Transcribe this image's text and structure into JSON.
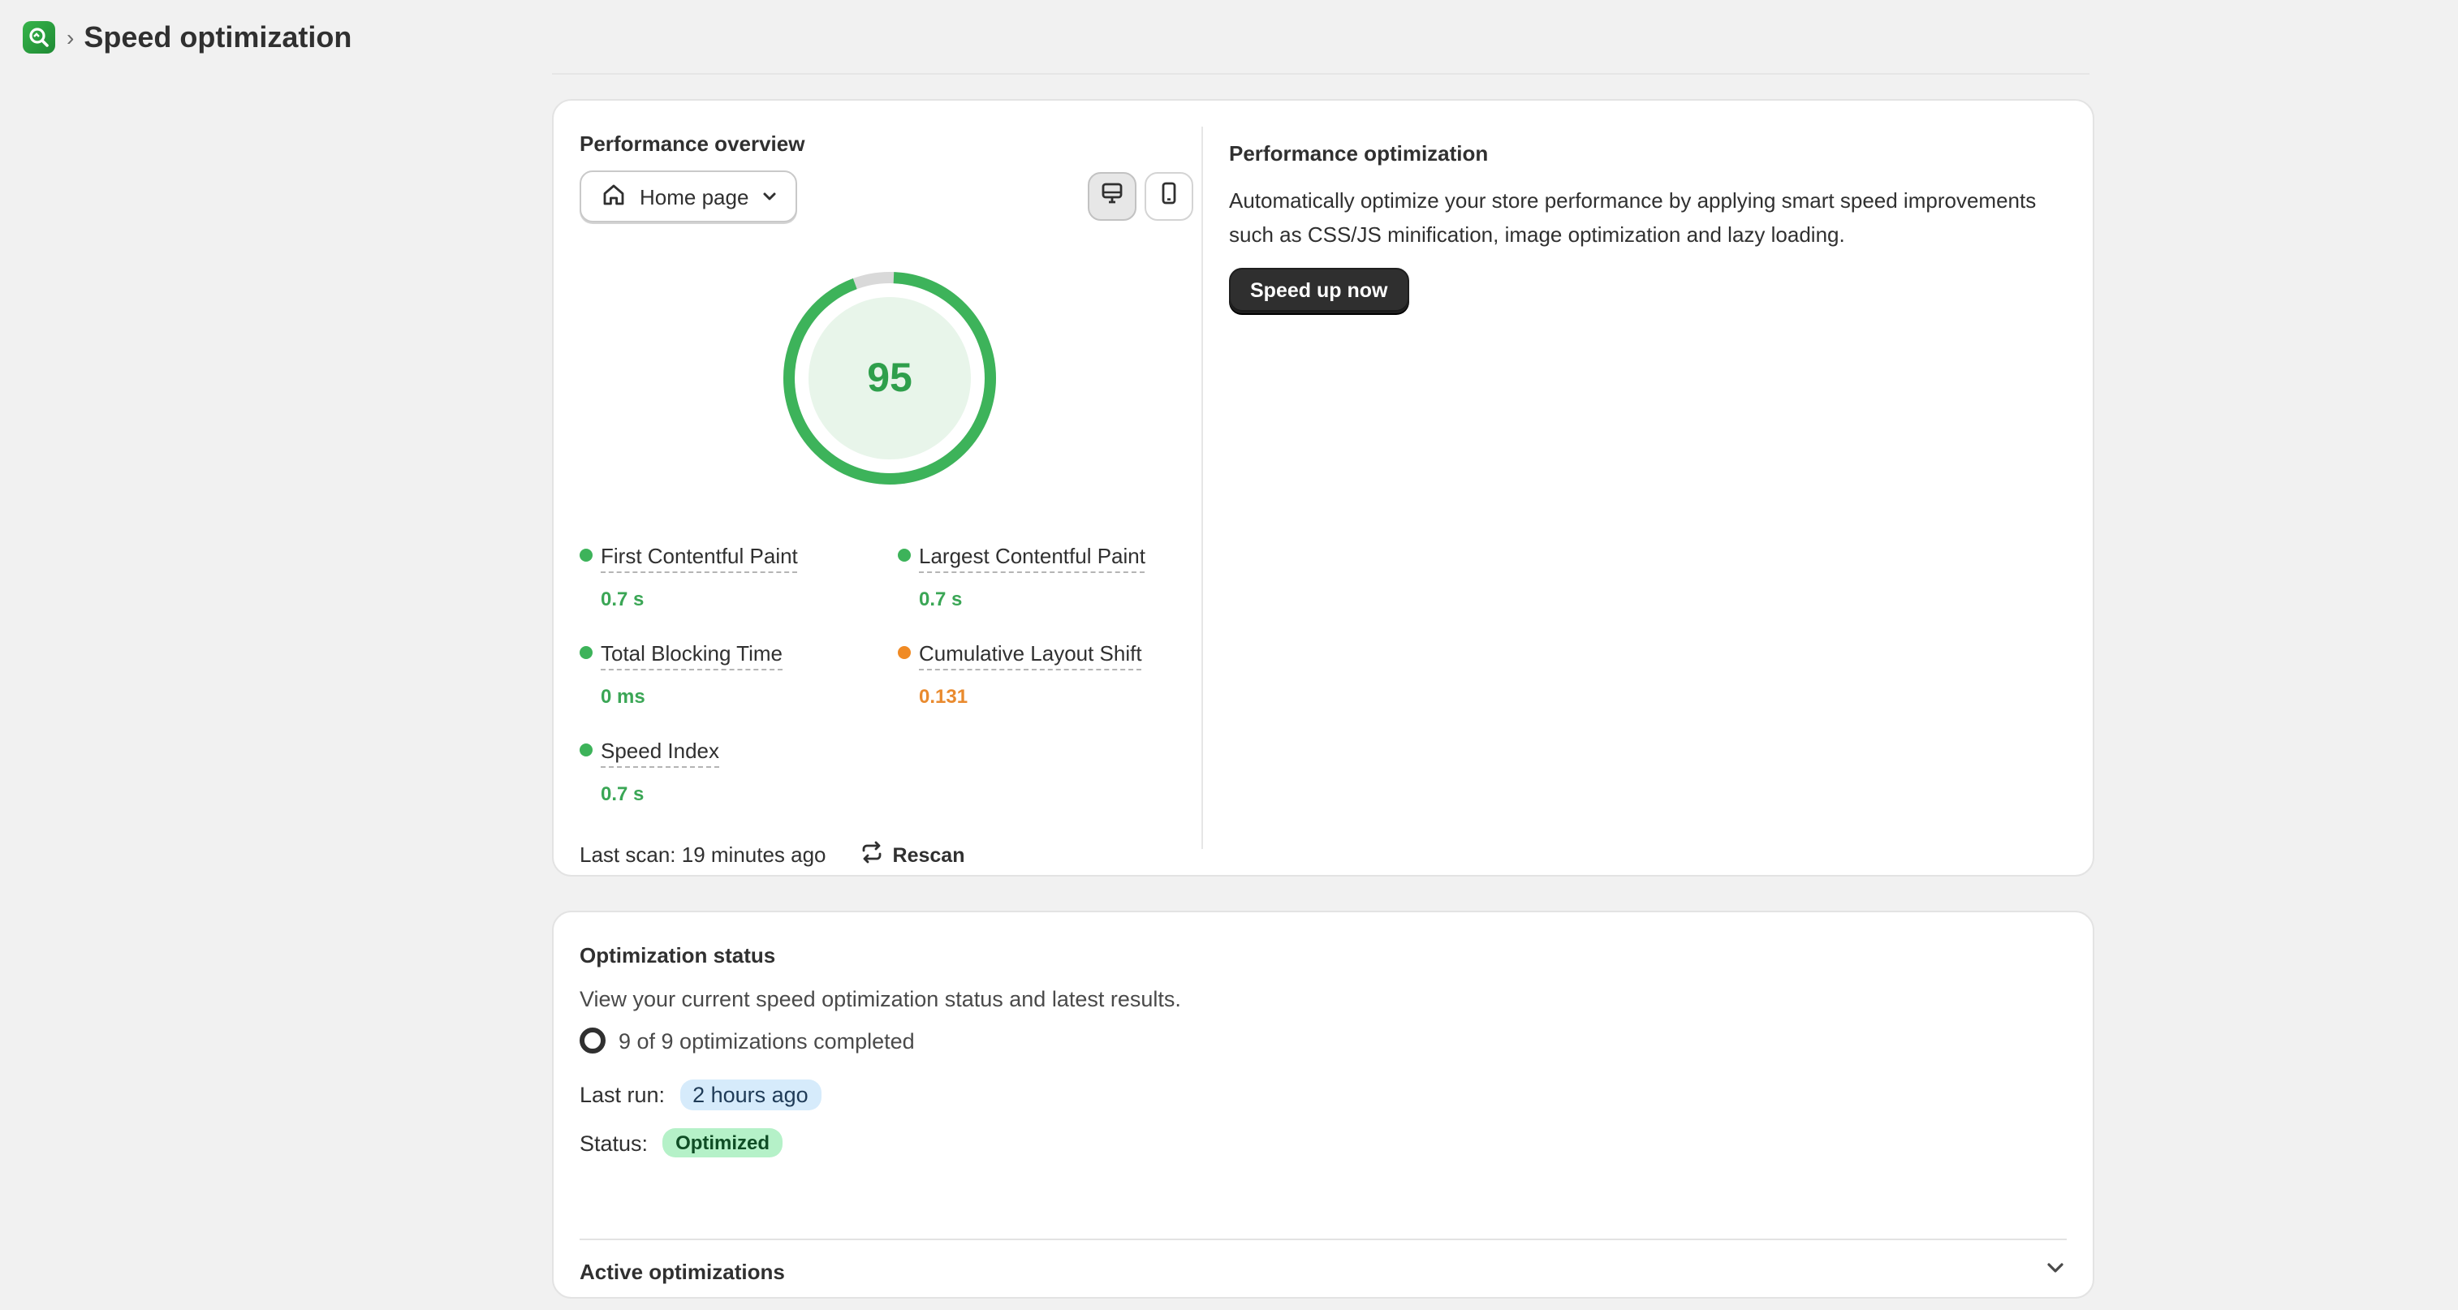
{
  "header": {
    "app_icon": "app-logo-icon",
    "separator": "›",
    "title": "Speed optimization"
  },
  "overview": {
    "title": "Performance overview",
    "page_select": {
      "value": "Home page",
      "icon": "home-icon"
    },
    "device_toggle": [
      {
        "name": "desktop",
        "icon": "desktop-icon",
        "active": true
      },
      {
        "name": "mobile",
        "icon": "mobile-icon",
        "active": false
      }
    ],
    "score": "95",
    "score_fraction": 0.95,
    "colors": {
      "good": "#3db35a",
      "warn": "#f08a24",
      "score_bg": "#e8f5ea"
    },
    "metrics": [
      {
        "label": "First Contentful Paint",
        "value": "0.7 s",
        "status": "green"
      },
      {
        "label": "Largest Contentful Paint",
        "value": "0.7 s",
        "status": "green"
      },
      {
        "label": "Total Blocking Time",
        "value": "0 ms",
        "status": "green"
      },
      {
        "label": "Cumulative Layout Shift",
        "value": "0.131",
        "status": "orange"
      },
      {
        "label": "Speed Index",
        "value": "0.7 s",
        "status": "green"
      }
    ],
    "last_scan": "Last scan: 19 minutes ago",
    "rescan_label": "Rescan"
  },
  "optimization": {
    "title": "Performance optimization",
    "description": "Automatically optimize your store performance by applying smart speed improvements such as CSS/JS minification, image optimization and lazy loading.",
    "button_label": "Speed up now"
  },
  "status": {
    "title": "Optimization status",
    "description": "View your current speed optimization status and latest results.",
    "progress_text": "9 of 9 optimizations completed",
    "last_run_label": "Last run:",
    "last_run_value": "2 hours ago",
    "status_label": "Status:",
    "status_value": "Optimized",
    "active_title": "Active optimizations"
  }
}
